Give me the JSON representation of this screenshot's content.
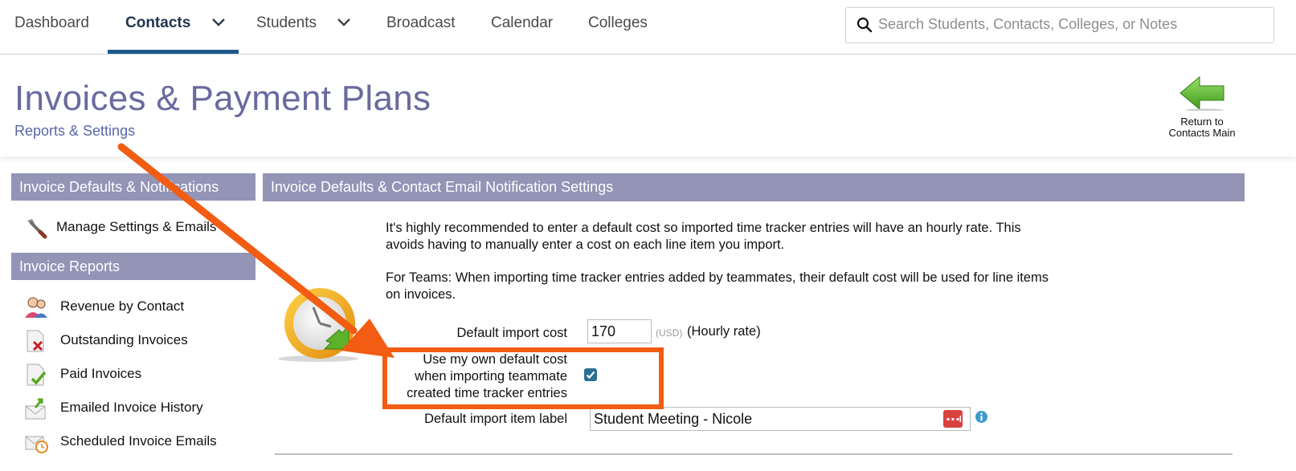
{
  "nav": {
    "items": [
      {
        "label": "Dashboard"
      },
      {
        "label": "Contacts"
      },
      {
        "label": "Students"
      },
      {
        "label": "Broadcast"
      },
      {
        "label": "Calendar"
      },
      {
        "label": "Colleges"
      }
    ],
    "active": "Contacts",
    "search_placeholder": "Search Students, Contacts, Colleges, or Notes"
  },
  "header": {
    "title": "Invoices & Payment Plans",
    "subtitle": "Reports & Settings",
    "return_line1": "Return to",
    "return_line2": "Contacts Main"
  },
  "sidebar": {
    "section1_title": "Invoice Defaults & Notifications",
    "section1_items": [
      {
        "label": "Manage Settings & Emails",
        "icon": "wrench-icon"
      }
    ],
    "section2_title": "Invoice Reports",
    "section2_items": [
      {
        "label": "Revenue by Contact",
        "icon": "users-icon"
      },
      {
        "label": "Outstanding Invoices",
        "icon": "invoice-x-icon"
      },
      {
        "label": "Paid Invoices",
        "icon": "invoice-check-icon"
      },
      {
        "label": "Emailed Invoice History",
        "icon": "email-arrow-icon"
      },
      {
        "label": "Scheduled Invoice Emails",
        "icon": "email-clock-icon"
      }
    ]
  },
  "main": {
    "section_title": "Invoice Defaults & Contact Email Notification Settings",
    "para1_line1": "It's highly recommended to enter a default cost so imported time tracker entries will have an hourly rate. This",
    "para1_line2": "avoids having to manually enter a cost on each line item you import.",
    "para2_line1": "For Teams: When importing time tracker entries added by teammates, their default cost will be used for line items",
    "para2_line2": "on invoices.",
    "cost_label": "Default import cost",
    "cost_value": "170",
    "currency": "(USD)",
    "rate_label": "(Hourly rate)",
    "own_cost_line1": "Use my own default cost",
    "own_cost_line2": "when importing teammate",
    "own_cost_line3": "created time tracker entries",
    "own_cost_checked": true,
    "item_label_label": "Default import item label",
    "item_label_value": "Student Meeting - Nicole"
  },
  "colors": {
    "accent_bar": "#9394b6",
    "title": "#6a6a9f",
    "annotation": "#f25c13",
    "nav_active_underline": "#1d5a8a"
  }
}
